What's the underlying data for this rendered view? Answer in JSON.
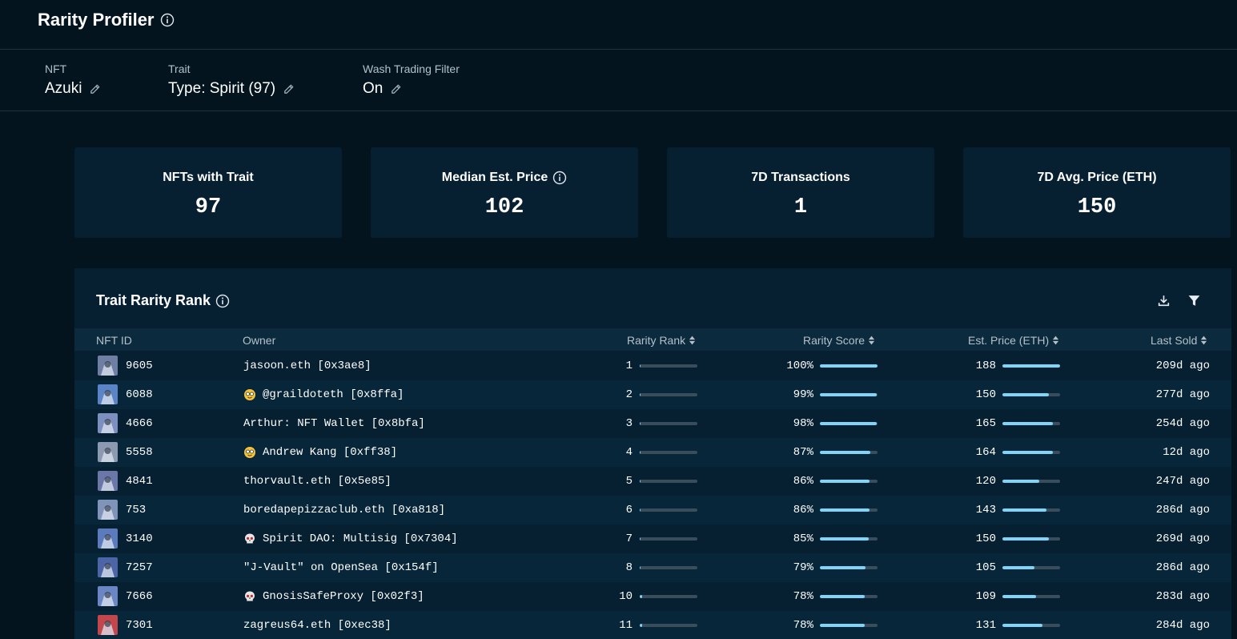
{
  "header": {
    "title": "Rarity Profiler"
  },
  "filters": {
    "nft": {
      "label": "NFT",
      "value": "Azuki"
    },
    "trait": {
      "label": "Trait",
      "value": "Type: Spirit (97)"
    },
    "wash": {
      "label": "Wash Trading Filter",
      "value": "On"
    }
  },
  "stats": [
    {
      "label": "NFTs with Trait",
      "value": "97",
      "has_info": false
    },
    {
      "label": "Median Est. Price",
      "value": "102",
      "has_info": true
    },
    {
      "label": "7D Transactions",
      "value": "1",
      "has_info": false
    },
    {
      "label": "7D Avg. Price (ETH)",
      "value": "150",
      "has_info": false
    }
  ],
  "table": {
    "title": "Trait Rarity Rank",
    "columns": {
      "nft_id": "NFT ID",
      "owner": "Owner",
      "rarity_rank": "Rarity Rank",
      "rarity_score": "Rarity Score",
      "est_price": "Est. Price (ETH)",
      "last_sold": "Last Sold"
    },
    "rows": [
      {
        "id": "9605",
        "owner": "jasoon.eth [0x3ae8]",
        "owner_icon": "",
        "rank": "1",
        "rank_fill": 0.02,
        "score": "100%",
        "score_fill": 1.0,
        "price": "188",
        "price_fill": 1.0,
        "last_sold": "209d ago",
        "thumb": "#6f7fa4"
      },
      {
        "id": "6088",
        "owner": "@graildoteth [0x8ffa]",
        "owner_icon": "emoji-face-icon",
        "rank": "2",
        "rank_fill": 0.02,
        "score": "99%",
        "score_fill": 0.99,
        "price": "150",
        "price_fill": 0.8,
        "last_sold": "277d ago",
        "thumb": "#5b84c7"
      },
      {
        "id": "4666",
        "owner": "Arthur: NFT Wallet [0x8bfa]",
        "owner_icon": "",
        "rank": "3",
        "rank_fill": 0.02,
        "score": "98%",
        "score_fill": 0.98,
        "price": "165",
        "price_fill": 0.88,
        "last_sold": "254d ago",
        "thumb": "#7d8fbf"
      },
      {
        "id": "5558",
        "owner": "Andrew Kang [0xff38]",
        "owner_icon": "emoji-face-icon",
        "rank": "4",
        "rank_fill": 0.02,
        "score": "87%",
        "score_fill": 0.87,
        "price": "164",
        "price_fill": 0.87,
        "last_sold": "12d ago",
        "thumb": "#8c99b0"
      },
      {
        "id": "4841",
        "owner": "thorvault.eth [0x5e85]",
        "owner_icon": "",
        "rank": "5",
        "rank_fill": 0.02,
        "score": "86%",
        "score_fill": 0.86,
        "price": "120",
        "price_fill": 0.64,
        "last_sold": "247d ago",
        "thumb": "#6a77a8"
      },
      {
        "id": "753",
        "owner": "boredapepizzaclub.eth [0xa818]",
        "owner_icon": "",
        "rank": "6",
        "rank_fill": 0.02,
        "score": "86%",
        "score_fill": 0.86,
        "price": "143",
        "price_fill": 0.76,
        "last_sold": "286d ago",
        "thumb": "#7f94b8"
      },
      {
        "id": "3140",
        "owner": "Spirit DAO: Multisig [0x7304]",
        "owner_icon": "skull-icon",
        "rank": "7",
        "rank_fill": 0.02,
        "score": "85%",
        "score_fill": 0.85,
        "price": "150",
        "price_fill": 0.8,
        "last_sold": "269d ago",
        "thumb": "#5c7bbd"
      },
      {
        "id": "7257",
        "owner": "\"J-Vault\" on OpenSea [0x154f]",
        "owner_icon": "",
        "rank": "8",
        "rank_fill": 0.02,
        "score": "79%",
        "score_fill": 0.79,
        "price": "105",
        "price_fill": 0.56,
        "last_sold": "286d ago",
        "thumb": "#4c65a6"
      },
      {
        "id": "7666",
        "owner": "GnosisSafeProxy [0x02f3]",
        "owner_icon": "skull-icon",
        "rank": "10",
        "rank_fill": 0.04,
        "score": "78%",
        "score_fill": 0.78,
        "price": "109",
        "price_fill": 0.58,
        "last_sold": "283d ago",
        "thumb": "#6a86c4"
      },
      {
        "id": "7301",
        "owner": "zagreus64.eth [0xec38]",
        "owner_icon": "",
        "rank": "11",
        "rank_fill": 0.04,
        "score": "78%",
        "score_fill": 0.78,
        "price": "131",
        "price_fill": 0.7,
        "last_sold": "284d ago",
        "thumb": "#c2474d"
      }
    ]
  },
  "colors": {
    "background": "#03141f",
    "card": "#061f31",
    "accent_bar": "#7fd4f7",
    "bar_track": "#3a4d5c"
  }
}
